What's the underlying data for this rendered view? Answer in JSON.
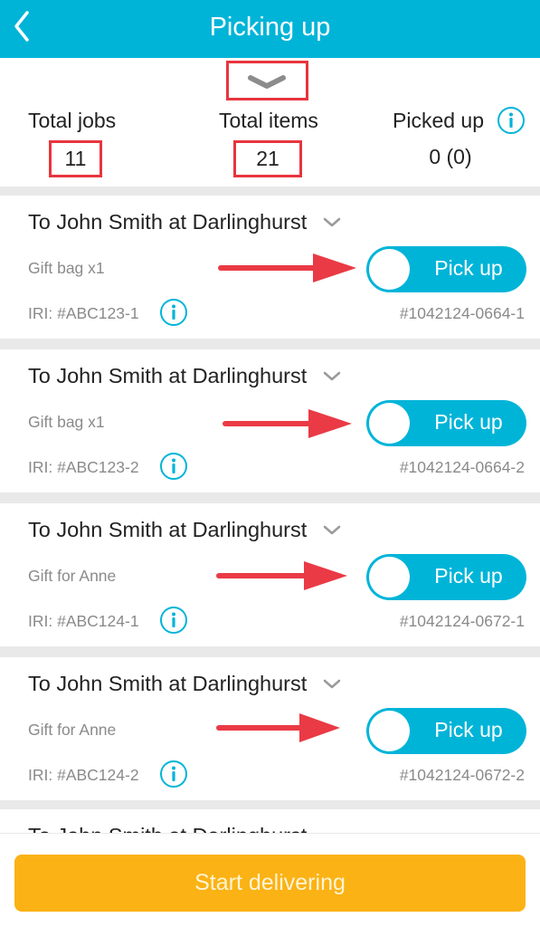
{
  "header": {
    "title": "Picking up"
  },
  "summary": {
    "total_jobs_label": "Total jobs",
    "total_jobs_value": "11",
    "total_items_label": "Total items",
    "total_items_value": "21",
    "picked_up_label": "Picked up",
    "picked_up_value": "0 (0)"
  },
  "jobs": [
    {
      "title": "To John Smith at Darlinghurst",
      "item": "Gift bag x1",
      "toggle_label": "Pick up",
      "iri": "IRI: #ABC123-1",
      "ref": "#1042124-0664-1"
    },
    {
      "title": "To John Smith at Darlinghurst",
      "item": "Gift bag x1",
      "toggle_label": "Pick up",
      "iri": "IRI: #ABC123-2",
      "ref": "#1042124-0664-2"
    },
    {
      "title": "To John Smith at Darlinghurst",
      "item": "Gift for Anne",
      "toggle_label": "Pick up",
      "iri": "IRI: #ABC124-1",
      "ref": "#1042124-0672-1"
    },
    {
      "title": "To John Smith at Darlinghurst",
      "item": "Gift for Anne",
      "toggle_label": "Pick up",
      "iri": "IRI: #ABC124-2",
      "ref": "#1042124-0672-2"
    },
    {
      "title": "To John Smith at Darlinghurst"
    }
  ],
  "footer": {
    "start_label": "Start delivering"
  },
  "colors": {
    "accent": "#00b4d8",
    "highlight": "#e8353e",
    "button": "#fbb215"
  }
}
